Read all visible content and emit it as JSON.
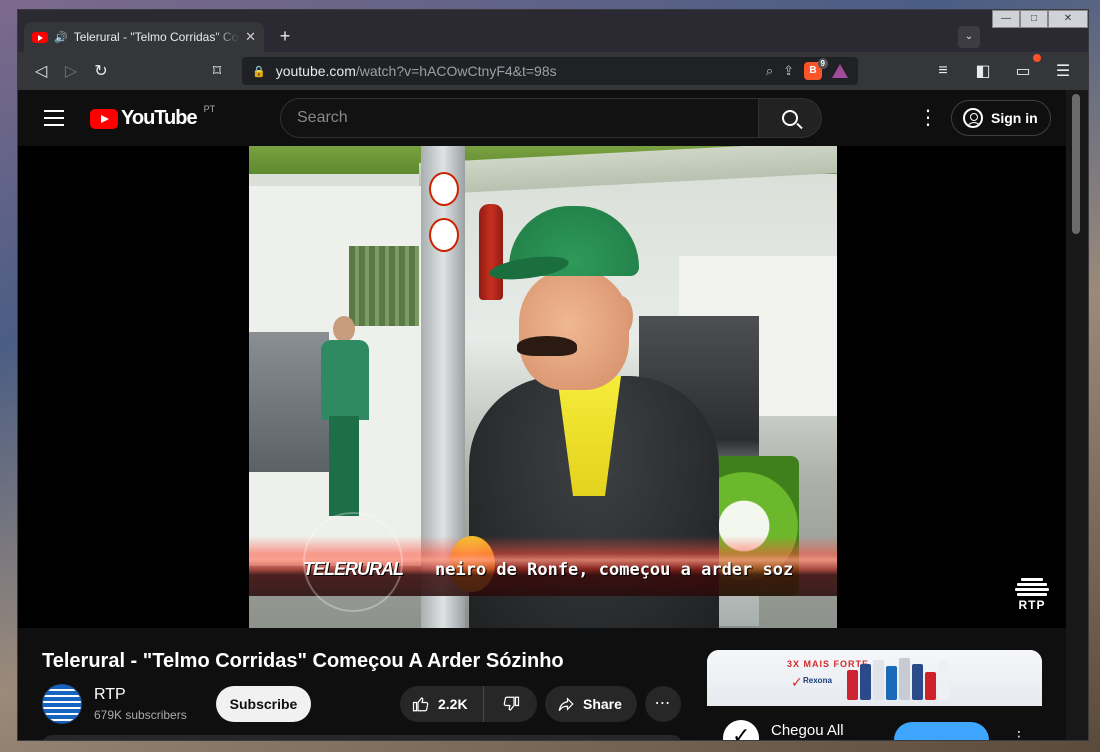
{
  "browser": {
    "tab": {
      "title": "Telerural - \"Telmo Corridas\" Começou A Arder Sózinho",
      "audio_icon": "speaker-icon",
      "close": "✕"
    },
    "new_tab": "+",
    "tab_search": "⌄",
    "window_controls": {
      "minimize": "—",
      "maximize": "□",
      "close": "✕"
    },
    "url_host": "youtube.com",
    "url_path": "/watch?v=hACOwCtnyF4&t=98s",
    "brave_shields_count": "9"
  },
  "youtube": {
    "logo_text": "YouTube",
    "country": "PT",
    "search_placeholder": "Search",
    "sign_in": "Sign in"
  },
  "video": {
    "overlay_logo": "TELERURAL",
    "caption": "neiro de Ronfe, começou a arder soz",
    "watermark": "RTP",
    "title": "Telerural - \"Telmo Corridas\" Começou A Arder Sózinho",
    "channel": "RTP",
    "subscribers": "679K subscribers",
    "subscribe": "Subscribe",
    "likes": "2.2K",
    "share": "Share",
    "more": "⋯"
  },
  "ad": {
    "headline": "3X MAIS FORTE",
    "brand": "Rexona",
    "channel_title": "Chegou All"
  },
  "colors": {
    "brand_red": "#ff0000",
    "accent_blue": "#3ea6ff",
    "background": "#0f0f0f"
  }
}
